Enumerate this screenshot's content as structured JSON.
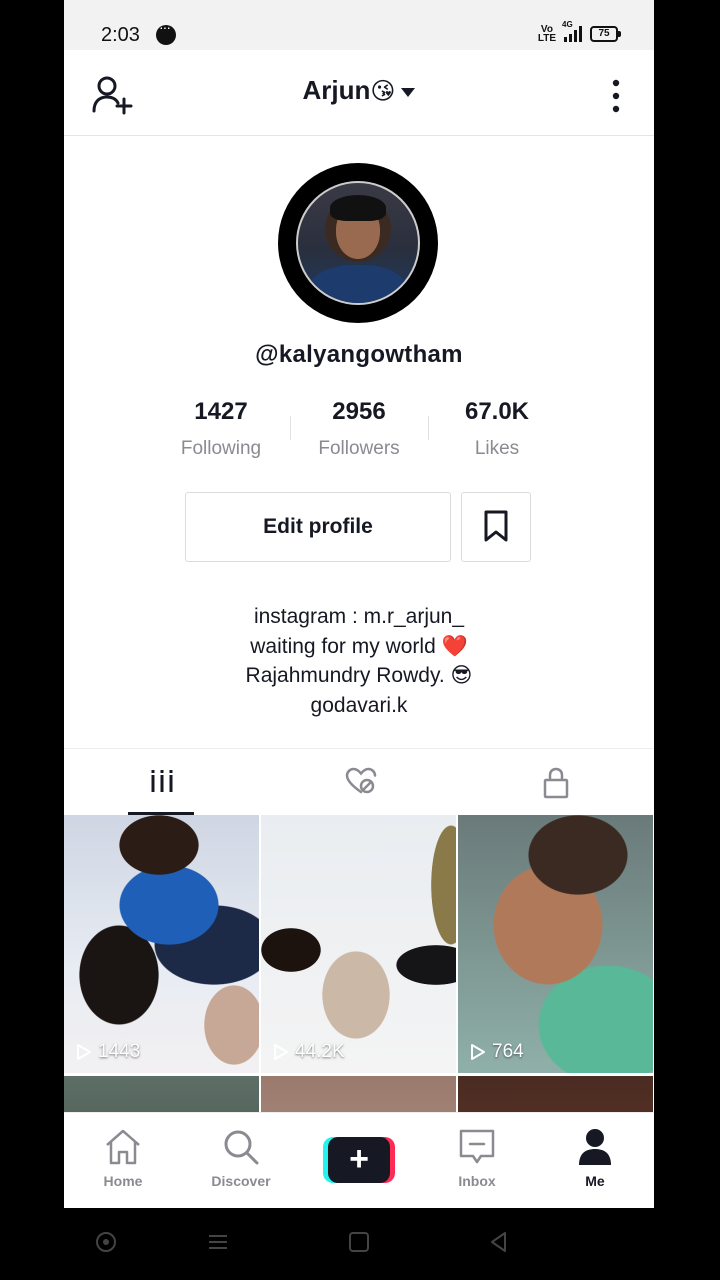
{
  "status_bar": {
    "time": "2:03",
    "network": "4G",
    "volte": "Vo LTE",
    "battery": "75"
  },
  "header": {
    "title": "Arjun",
    "title_emoji": "😘"
  },
  "profile": {
    "username": "@kalyangowtham",
    "stats": [
      {
        "value": "1427",
        "label": "Following"
      },
      {
        "value": "2956",
        "label": "Followers"
      },
      {
        "value": "67.0K",
        "label": "Likes"
      }
    ],
    "edit_label": "Edit profile",
    "bio": [
      "instagram : m.r_arjun_",
      "waiting for my world ❤️",
      "Rajahmundry Rowdy.  😎",
      "godavari.k"
    ]
  },
  "videos": [
    {
      "views": "1443"
    },
    {
      "views": "44.2K"
    },
    {
      "views": "764"
    }
  ],
  "bottom_nav": {
    "home": "Home",
    "discover": "Discover",
    "create": "+",
    "inbox": "Inbox",
    "me": "Me"
  },
  "icons": {
    "add_user": "add-user-icon",
    "more": "more-vertical-icon",
    "bookmark": "bookmark-icon",
    "grid_tab": "grid-icon",
    "liked_tab": "liked-hidden-icon",
    "private_tab": "lock-icon"
  }
}
